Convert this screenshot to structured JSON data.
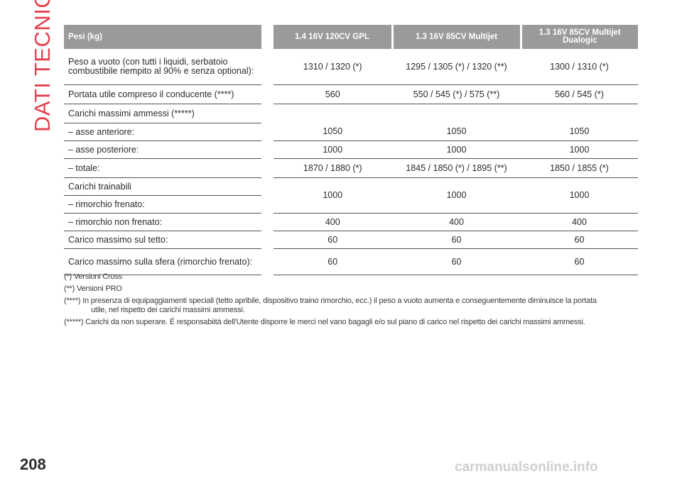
{
  "side_title": "DATI TECNICI",
  "table": {
    "headers": [
      "Pesi (kg)",
      "1.4 16V 120CV GPL",
      "1.3 16V 85CV Multijet",
      "1.3 16V 85CV Multijet Dualogic"
    ],
    "rows": {
      "peso_vuoto": {
        "label": "Peso a vuoto (con tutti i liquidi, serbatoio combustibile riempito al 90% e senza optional):",
        "v1": "1310 / 1320 (*)",
        "v2": "1295 / 1305 (*) / 1320 (**)",
        "v3": "1300 / 1310 (*)"
      },
      "portata": {
        "label": "Portata utile compreso il conducente (****)",
        "v1": "560",
        "v2": "550 / 545 (*) / 575 (**)",
        "v3": "560 / 545 (*)"
      },
      "carichi_max": {
        "label": "Carichi massimi ammessi (*****)"
      },
      "asse_anteriore": {
        "label": "– asse anteriore:",
        "v1": "1050",
        "v2": "1050",
        "v3": "1050"
      },
      "asse_posteriore": {
        "label": "– asse posteriore:",
        "v1": "1000",
        "v2": "1000",
        "v3": "1000"
      },
      "totale": {
        "label": "– totale:",
        "v1": "1870 / 1880 (*)",
        "v2": "1845 / 1850 (*) / 1895 (**)",
        "v3": "1850 / 1855 (*)"
      },
      "carichi_trainabili": {
        "label": "Carichi trainabili"
      },
      "rimorchio_frenato": {
        "label": "– rimorchio frenato:",
        "v1": "1000",
        "v2": "1000",
        "v3": "1000"
      },
      "rimorchio_non_frenato": {
        "label": "– rimorchio non frenato:",
        "v1": "400",
        "v2": "400",
        "v3": "400"
      },
      "tetto": {
        "label": "Carico massimo sul tetto:",
        "v1": "60",
        "v2": "60",
        "v3": "60"
      },
      "sfera": {
        "label": "Carico massimo sulla sfera (rimorchio frenato):",
        "v1": "60",
        "v2": "60",
        "v3": "60"
      }
    }
  },
  "notes": {
    "n1": "(*) Versioni Cross",
    "n2": "(**) Versioni PRO",
    "n3_line1": "(****) In presenza di equipaggiamenti speciali (tetto apribile, dispositivo traino rimorchio, ecc.) il peso a vuoto aumenta e conseguentemente diminuisce la portata",
    "n3_line2": "utile, nel rispetto dei carichi massimi ammessi.",
    "n4": "(*****) Carichi da non superare. É responsabiità dell'Utente disporre le merci nel vano bagagli e/o sul piano di carico nel rispetto dei carichi massimi ammessi."
  },
  "page_number": "208",
  "watermark": "carmanualsonline.info"
}
